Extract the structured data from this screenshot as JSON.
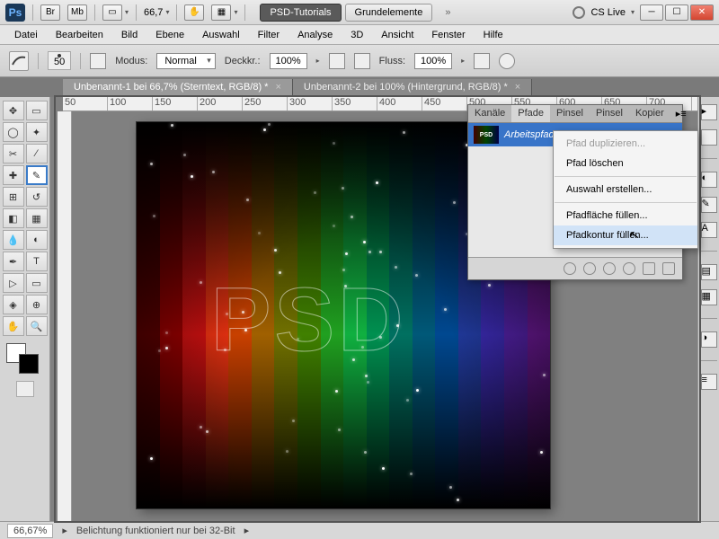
{
  "titlebar": {
    "logo": "Ps",
    "br": "Br",
    "mb": "Mb",
    "zoom": "66,7",
    "docs": [
      {
        "label": "PSD-Tutorials",
        "active": true
      },
      {
        "label": "Grundelemente",
        "active": false
      }
    ],
    "cslive": "CS Live",
    "chevrons": "»"
  },
  "menu": [
    "Datei",
    "Bearbeiten",
    "Bild",
    "Ebene",
    "Auswahl",
    "Filter",
    "Analyse",
    "3D",
    "Ansicht",
    "Fenster",
    "Hilfe"
  ],
  "options": {
    "brush_size": "50",
    "mode_label": "Modus:",
    "mode_value": "Normal",
    "opacity_label": "Deckkr.:",
    "opacity_value": "100%",
    "flow_label": "Fluss:",
    "flow_value": "100%"
  },
  "doc_tabs": [
    {
      "label": "Unbenannt-1 bei 66,7% (Sterntext, RGB/8) *",
      "active": true
    },
    {
      "label": "Unbenannt-2 bei 100% (Hintergrund, RGB/8) *",
      "active": false
    }
  ],
  "ruler_ticks": [
    "50",
    "100",
    "150",
    "200",
    "250",
    "300",
    "350",
    "400",
    "450",
    "500",
    "550",
    "600",
    "650",
    "700"
  ],
  "toolbox": {
    "tools": [
      "▭",
      "▸",
      "⊡",
      "✦",
      "⊿",
      "◢",
      "裁",
      "✎",
      "◐",
      "笔",
      "✦",
      "✒",
      "⟳",
      "◧",
      "⌫",
      "⬚",
      "◯",
      "◔",
      "渐",
      "桶",
      "✎",
      "✐",
      "▷",
      "T",
      "↖",
      "⬠",
      "✋",
      "🔍"
    ],
    "selected_index": 11
  },
  "paths_panel": {
    "tabs": [
      "Kanäle",
      "Pfade",
      "Pinsel",
      "Pinsel",
      "Kopier"
    ],
    "active_tab": 1,
    "item_label": "Arbeitspfad",
    "thumb": "PSD"
  },
  "context_menu": {
    "items": [
      {
        "label": "Pfad duplizieren...",
        "disabled": true
      },
      {
        "label": "Pfad löschen"
      },
      {
        "sep": true
      },
      {
        "label": "Auswahl erstellen..."
      },
      {
        "sep": true
      },
      {
        "label": "Pfadfläche füllen..."
      },
      {
        "label": "Pfadkontur füllen...",
        "hover": true
      }
    ]
  },
  "canvas": {
    "text": "PSD",
    "stripe_colors": [
      "#5a0000",
      "#950000",
      "#c81010",
      "#e03010",
      "#c84000",
      "#a06000",
      "#707000",
      "#408000",
      "#20a020",
      "#10b040",
      "#009050",
      "#007060",
      "#005878",
      "#004890",
      "#203898",
      "#3828a8",
      "#5020a0",
      "#681890"
    ]
  },
  "status": {
    "zoom": "66,67%",
    "msg": "Belichtung funktioniert nur bei 32-Bit"
  }
}
